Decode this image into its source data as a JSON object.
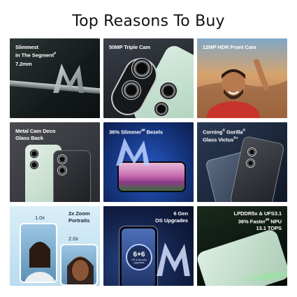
{
  "page": {
    "title": "Top Reasons To Buy"
  },
  "tiles": [
    {
      "label_1": "Slimmest",
      "label_2": "In The Segment",
      "sup": "#",
      "label_3": "7.2mm",
      "bg": "#1c2424"
    },
    {
      "label_1": "50MP Triple Cam",
      "bg": "#2a2e36"
    },
    {
      "label_1": "12MP HDR Front Cam",
      "bg": "#c98a52"
    },
    {
      "label_1": "Metal Cam Deco",
      "label_2": "Glass Back",
      "bg": "#3a3c42"
    },
    {
      "label_1": "36% Slimmer",
      "sup": "##",
      "label_2": "Bezels",
      "bg": "#142a66"
    },
    {
      "label_1": "Corning",
      "sup_a": "®",
      "label_1b": "Gorilla",
      "sup_b": "®",
      "label_2": "Glass Victus",
      "sup_c": "®+",
      "bg": "#1a2a40"
    },
    {
      "label_1": "2x Zoom",
      "label_2": "Portraits",
      "zoom_1": "1.0x",
      "zoom_2": "2.0x",
      "bg": "#cfe6f3"
    },
    {
      "label_1": "6 Gen",
      "label_2": "OS Upgrades",
      "badge_big": "6+6",
      "badge_small_1": "OS & security",
      "badge_small_2": "upgrades",
      "bg": "#0e1a3a"
    },
    {
      "label_1": "LPDDR5x & UFS3.1",
      "label_2": "36% Faster",
      "sup": "##",
      "label_2b": "NPU",
      "label_3": "13.1 TOPS",
      "bg": "#0f1810"
    }
  ]
}
